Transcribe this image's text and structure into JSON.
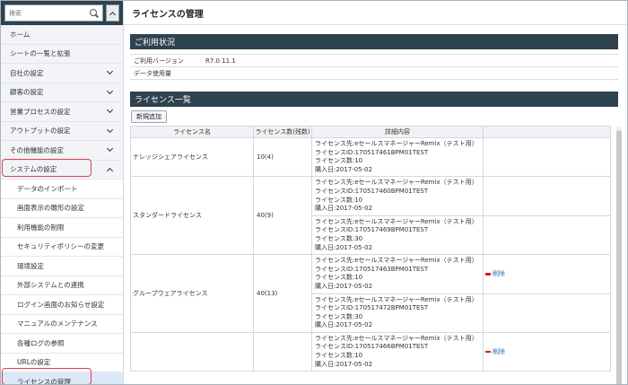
{
  "sidebar": {
    "search_placeholder": "検索",
    "items": [
      {
        "label": "ホーム"
      },
      {
        "label": "シートの一覧と拡張"
      },
      {
        "label": "自社の設定"
      },
      {
        "label": "顧客の設定"
      },
      {
        "label": "営業プロセスの設定"
      },
      {
        "label": "アウトプットの設定"
      },
      {
        "label": "その他機能の設定"
      },
      {
        "label": "システムの設定"
      }
    ],
    "sub_items": [
      {
        "label": "データのインポート"
      },
      {
        "label": "画面表示の雛形の設定"
      },
      {
        "label": "利用機能の制限"
      },
      {
        "label": "セキュリティポリシーの変更"
      },
      {
        "label": "環境設定"
      },
      {
        "label": "外部システムとの連携"
      },
      {
        "label": "ログイン画面のお知らせ設定"
      },
      {
        "label": "マニュアルのメンテナンス"
      },
      {
        "label": "各種ログの参照"
      },
      {
        "label": "URLの設定"
      },
      {
        "label": "ライセンスの管理"
      }
    ]
  },
  "main": {
    "title": "ライセンスの管理",
    "usage": {
      "heading": "ご利用状況",
      "version_label": "ご利用バージョン",
      "version_value": "R7.0.11.1",
      "data_label": "データ使用量",
      "data_value": ""
    },
    "licenses": {
      "heading": "ライセンス一覧",
      "new_button": "新規追加",
      "columns": {
        "name": "ライセンス名",
        "count": "ライセンス数(残数)",
        "detail": "詳細内容"
      },
      "delete_label": "削除",
      "rows": [
        {
          "name": "ナレッジシェアライセンス",
          "count": "10(4)",
          "entries": [
            [
              "ライセンス先:eセールスマネージャーRemix（テスト用）",
              "ライセンスID:170517461BPM01TEST",
              "ライセンス数:10",
              "購入日:2017-05-02"
            ]
          ]
        },
        {
          "name": "スタンダードライセンス",
          "count": "40(9)",
          "entries": [
            [
              "ライセンス先:eセールスマネージャーRemix（テスト用）",
              "ライセンスID:170517460BPM01TEST",
              "ライセンス数:10",
              "購入日:2017-05-02"
            ],
            [
              "ライセンス先:eセールスマネージャーRemix（テスト用）",
              "ライセンスID:170517469BPM01TEST",
              "ライセンス数:30",
              "購入日:2017-05-02"
            ]
          ]
        },
        {
          "name": "グループウェアライセンス",
          "count": "40(13)",
          "entries": [
            [
              "ライセンス先:eセールスマネージャーRemix（テスト用）",
              "ライセンスID:170517463BPM01TEST",
              "ライセンス数:10",
              "購入日:2017-05-02"
            ],
            [
              "ライセンス先:eセールスマネージャーRemix（テスト用）",
              "ライセンスID:170517472BPM01TEST",
              "ライセンス数:30",
              "購入日:2017-05-02"
            ]
          ]
        },
        {
          "name": "",
          "count": "",
          "entries": [
            [
              "ライセンス先:eセールスマネージャーRemix（テスト用）",
              "ライセンスID:170517466BPM01TEST",
              "ライセンス数:10",
              "購入日:2017-05-02"
            ]
          ]
        }
      ]
    }
  }
}
